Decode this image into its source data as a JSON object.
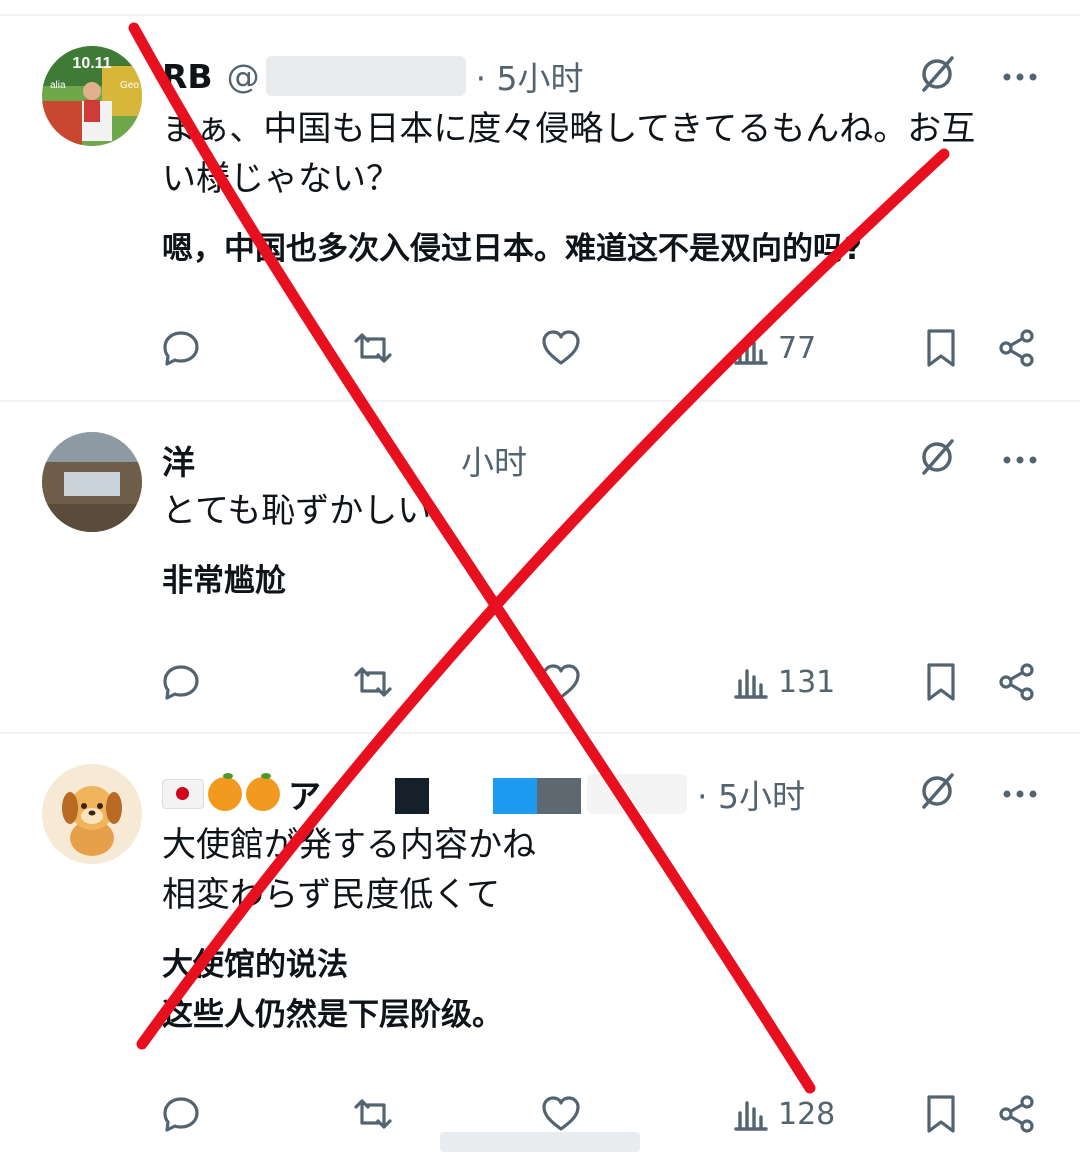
{
  "accent_color": "#e8101e",
  "icon_color": "#536471",
  "tweets": [
    {
      "name": "RB",
      "handle": "@",
      "dot_time": "· 5小时",
      "body_jp": "まぁ、中国も日本に度々侵略してきてるもんね。お互\nい様じゃない？",
      "body_cn": "嗯，中国也多次入侵过日本。难道这不是双向的吗?",
      "views": "77",
      "avatar_label": "10.11",
      "avatar_small": "alia",
      "avatar_small2": "Geo"
    },
    {
      "name": "洋",
      "dot_time": "小时",
      "body_jp": "とても恥ずかしい",
      "body_cn": "非常尴尬",
      "views": "131"
    },
    {
      "name_prefix": "🇯🇵🍊🍊",
      "name": "ア",
      "dot_time": "· 5小时",
      "body_jp": "大使館が発する内容かね\n相変わらず民度低くて",
      "body_cn": "大使馆的说法\n这些人仍然是下层阶级。",
      "views": "128"
    }
  ],
  "icons": [
    "reply-icon",
    "retweet-icon",
    "like-icon",
    "views-icon",
    "bookmark-icon",
    "share-icon",
    "grok-icon",
    "more-icon"
  ]
}
